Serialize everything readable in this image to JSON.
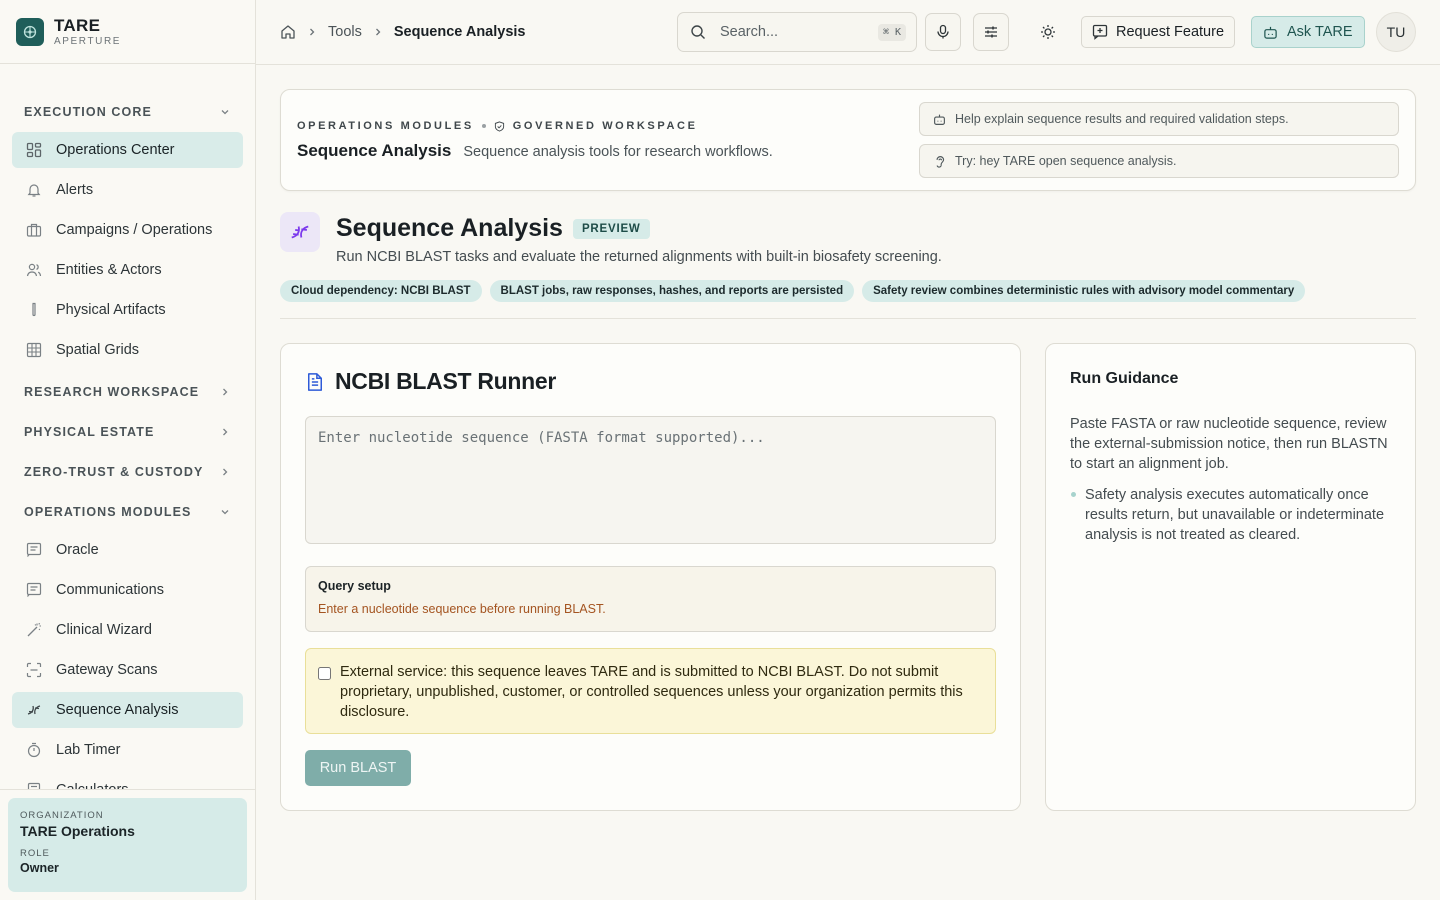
{
  "brand": {
    "name": "TARE",
    "sub": "APERTURE"
  },
  "sidebar": {
    "groups": {
      "execution_core": "EXECUTION CORE",
      "research_workspace": "RESEARCH WORKSPACE",
      "physical_estate": "PHYSICAL ESTATE",
      "zero_trust": "ZERO-TRUST & CUSTODY",
      "operations_modules": "OPERATIONS MODULES"
    },
    "core_items": [
      {
        "label": "Operations Center",
        "icon": "grid-icon"
      },
      {
        "label": "Alerts",
        "icon": "bell-icon"
      },
      {
        "label": "Campaigns / Operations",
        "icon": "briefcase-icon"
      },
      {
        "label": "Entities & Actors",
        "icon": "users-icon"
      },
      {
        "label": "Physical Artifacts",
        "icon": "test-tube-icon"
      },
      {
        "label": "Spatial Grids",
        "icon": "table-grid-icon"
      }
    ],
    "module_items": [
      {
        "label": "Oracle",
        "icon": "message-square-icon"
      },
      {
        "label": "Communications",
        "icon": "message-square-icon"
      },
      {
        "label": "Clinical Wizard",
        "icon": "wand-icon"
      },
      {
        "label": "Gateway Scans",
        "icon": "scan-icon"
      },
      {
        "label": "Sequence Analysis",
        "icon": "dna-icon"
      },
      {
        "label": "Lab Timer",
        "icon": "timer-icon"
      },
      {
        "label": "Calculators",
        "icon": "calculator-icon"
      }
    ],
    "org": {
      "org_label": "ORGANIZATION",
      "org_value": "TARE Operations",
      "role_label": "ROLE",
      "role_value": "Owner"
    }
  },
  "topbar": {
    "breadcrumb": [
      "Tools",
      "Sequence Analysis"
    ],
    "search_placeholder": "Search...",
    "search_shortcut": "⌘ K",
    "request_feature": "Request Feature",
    "ask": "Ask TARE",
    "avatar_initials": "TU"
  },
  "hero": {
    "eyebrow_left": "OPERATIONS MODULES",
    "eyebrow_right": "GOVERNED WORKSPACE",
    "title": "Sequence Analysis",
    "description": "Sequence analysis tools for research workflows.",
    "hint_1": "Help explain sequence results and required validation steps.",
    "hint_2": "Try: hey TARE open sequence analysis."
  },
  "page": {
    "title": "Sequence Analysis",
    "badge": "PREVIEW",
    "subtitle": "Run NCBI BLAST tasks and evaluate the returned alignments with built-in biosafety screening.",
    "chips": [
      "Cloud dependency: NCBI BLAST",
      "BLAST jobs, raw responses, hashes, and reports are persisted",
      "Safety review combines deterministic rules with advisory model commentary"
    ]
  },
  "runner": {
    "title": "NCBI BLAST Runner",
    "sequence_placeholder": "Enter nucleotide sequence (FASTA format supported)...",
    "sequence_value": "",
    "query_title": "Query setup",
    "query_warning": "Enter a nucleotide sequence before running BLAST.",
    "notice": "External service: this sequence leaves TARE and is submitted to NCBI BLAST. Do not submit proprietary, unpublished, customer, or controlled sequences unless your organization permits this disclosure.",
    "notice_checked": false,
    "run_label": "Run BLAST"
  },
  "guidance": {
    "title": "Run Guidance",
    "paragraph": "Paste FASTA or raw nucleotide sequence, review the external-submission notice, then run BLASTN to start an alignment job.",
    "bullets": [
      "Safety analysis executes automatically once results return, but unavailable or indeterminate analysis is not treated as cleared."
    ]
  },
  "colors": {
    "accent": "#1f5e5a",
    "active_bg": "#d9ece9",
    "warning_text": "#a45421",
    "notice_bg": "#fbf6d8",
    "dna_purple": "#7c3aed"
  }
}
